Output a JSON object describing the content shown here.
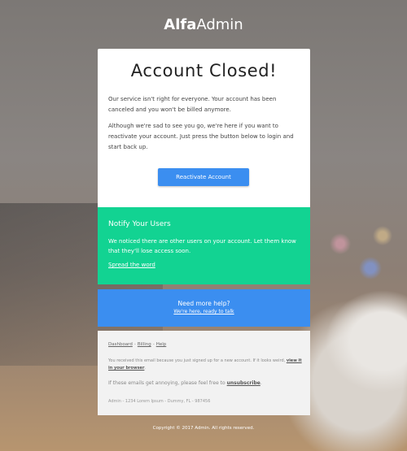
{
  "brand": {
    "bold": "Alfa",
    "rest": "Admin"
  },
  "main": {
    "title": "Account Closed!",
    "paragraph1": "Our service isn't right for everyone. Your account has been canceled and you won't be billed anymore.",
    "paragraph2": "Although we're sad to see you go, we're here if you want to reactivate your account. Just press the button below to login and start back up.",
    "button_label": "Reactivate Account"
  },
  "notify": {
    "title": "Notify Your Users",
    "body": "We noticed there are other users on your account. Let them know that they'll lose access soon.",
    "link": "Spread the word"
  },
  "help": {
    "title": "Need more help?",
    "link": "We're here, ready to talk"
  },
  "footer": {
    "links": [
      "Dashboard",
      "Billing",
      "Help"
    ],
    "separator": "-",
    "notice_text": "You received this email because you just signed up for a new account. If it looks weird,",
    "notice_link": "view it in your browser",
    "notice_end": ".",
    "unsub_text": "If these emails get annoying, please feel free to",
    "unsub_link": "unsubscribe",
    "unsub_end": ".",
    "address": "Admin - 1234 Lorem Ipsum - Dummy, FL - 987456"
  },
  "copyright": "Copyright © 2017 Admin. All rights reserved.",
  "colors": {
    "accent_blue": "#3b8ef0",
    "accent_green": "#12d392",
    "card": "#ffffff",
    "footer_bg": "#f2f2f2"
  }
}
